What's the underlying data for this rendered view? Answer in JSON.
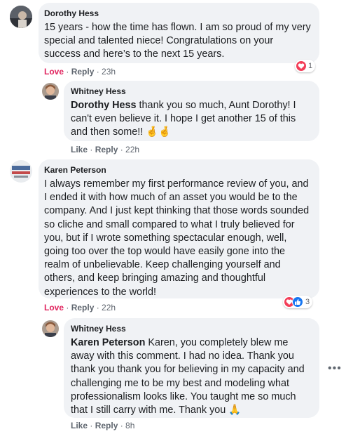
{
  "comments": [
    {
      "author": "Dorothy Hess",
      "text": "15 years - how the time has flown. I am so proud of my very special and talented niece! Congratulations on your success and here’s to the next 15 years.",
      "action_react": "Love",
      "action_reply": "Reply",
      "time": "23h",
      "reaction_count": "1",
      "reaction_icons": [
        "heart-icon"
      ]
    },
    {
      "author": "Whitney Hess",
      "mention": "Dorothy Hess",
      "text": " thank you so much, Aunt Dorothy! I can't even believe it. I hope I get another 15 of this and then some!! 🤞🤞",
      "action_react": "Like",
      "action_reply": "Reply",
      "time": "22h"
    },
    {
      "author": "Karen Peterson",
      "text": "I always remember my first performance review of you, and I ended it with how much of an asset you would be to the company. And I just kept thinking that those words sounded so cliche and small compared to what I truly believed for you, but if I wrote something spectacular enough, well, going too over the top would have easily gone into the realm of unbelievable. Keep challenging yourself and others, and keep bringing amazing and thoughtful experiences to the world!",
      "action_react": "Love",
      "action_reply": "Reply",
      "time": "22h",
      "reaction_count": "3",
      "reaction_icons": [
        "heart-icon",
        "like-icon"
      ]
    },
    {
      "author": "Whitney Hess",
      "mention": "Karen Peterson",
      "text": " Karen, you completely blew me away with this comment. I had no idea. Thank you thank you thank you for believing in my capacity and challenging me to be my best and modeling what professionalism looks like. You taught me so much that I still carry with me. Thank you 🙏",
      "action_react": "Like",
      "action_reply": "Reply",
      "time": "8h"
    }
  ],
  "separator": " · ",
  "more_options_icon": "more-options-icon",
  "colors": {
    "bubble": "#f0f2f5",
    "love": "#e0245e",
    "heart": "#f33e58",
    "like": "#1877f2"
  }
}
